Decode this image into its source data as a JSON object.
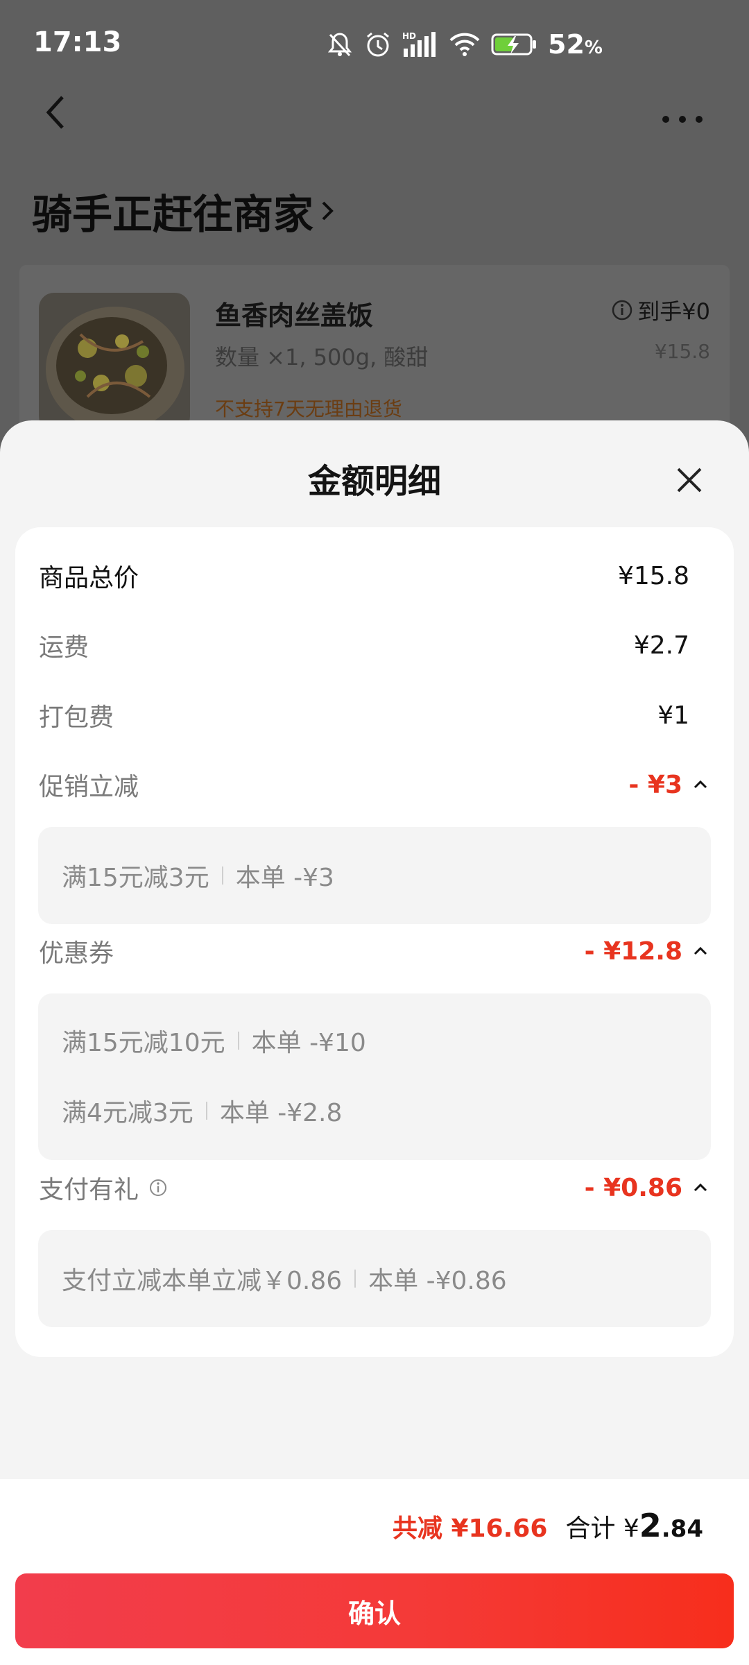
{
  "status_bar": {
    "time": "17:13",
    "battery": "52",
    "battery_unit": "%"
  },
  "page": {
    "order_status": "骑手正赶往商家",
    "item": {
      "name": "鱼香肉丝盖饭",
      "spec": "数量 ×1, 500g, 酸甜",
      "notice": "不支持7天无理由退货",
      "final_price_label": "到手¥0",
      "original_price": "¥15.8"
    }
  },
  "sheet": {
    "title": "金额明细",
    "rows": {
      "goods": {
        "label": "商品总价",
        "value": "¥15.8"
      },
      "shipping": {
        "label": "运费",
        "value": "¥2.7"
      },
      "packing": {
        "label": "打包费",
        "value": "¥1"
      },
      "promo": {
        "label": "促销立减",
        "value": "- ¥3",
        "items": [
          {
            "rule": "满15元减3元",
            "amount": "本单 -¥3"
          }
        ]
      },
      "coupon": {
        "label": "优惠券",
        "value": "- ¥12.8",
        "items": [
          {
            "rule": "满15元减10元",
            "amount": "本单 -¥10"
          },
          {
            "rule": "满4元减3元",
            "amount": "本单 -¥2.8"
          }
        ]
      },
      "payment": {
        "label": "支付有礼",
        "value": "- ¥0.86",
        "items": [
          {
            "rule": "支付立减本单立减￥0.86",
            "amount": "本单 -¥0.86"
          }
        ]
      }
    }
  },
  "footer": {
    "total_reduce": "共减 ¥16.66",
    "total_label": "合计 ¥",
    "total_int": "2",
    "total_dec": ".84",
    "confirm": "确认"
  },
  "colors": {
    "accent_red": "#e8341f",
    "button_gradient_start": "#f23d4c",
    "button_gradient_end": "#f72e1c"
  }
}
